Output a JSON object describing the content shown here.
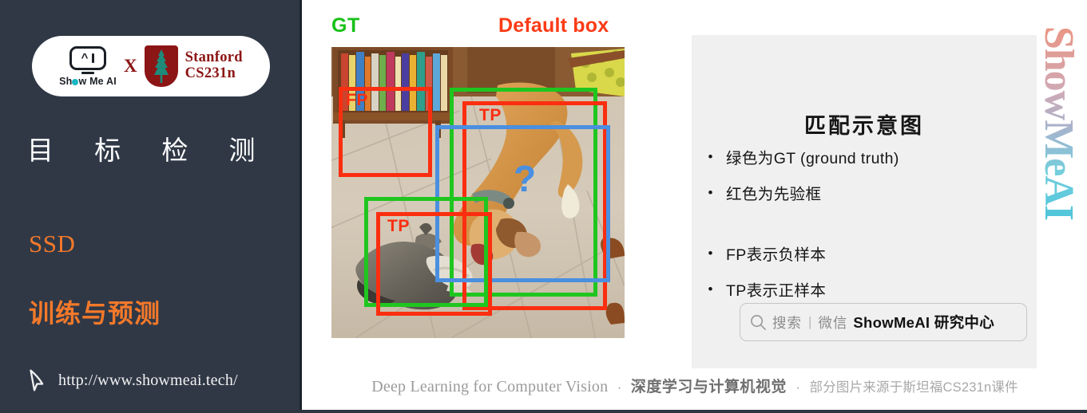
{
  "sidebar": {
    "logo": {
      "showmeai_text": "Show Me AI",
      "cross": "X",
      "stanford_line1": "Stanford",
      "stanford_line2": "CS231n"
    },
    "title": "目 标 检 测",
    "subtitle_1": "SSD",
    "subtitle_2": "训练与预测",
    "url": "http://www.showmeai.tech/",
    "bg_color": "#303846",
    "accent_color": "#F4792A"
  },
  "figure": {
    "label_gt": "GT",
    "label_default": "Default box",
    "gt_color": "#18C018",
    "default_color": "#FB3B16",
    "pred_color": "#4A8FE0",
    "annotations": [
      {
        "label": "FP",
        "color": "#FB2E10"
      },
      {
        "label": "TP",
        "color": "#FB2E10"
      },
      {
        "label": "TP",
        "color": "#FB2E10"
      }
    ],
    "question_mark": "?"
  },
  "right_panel": {
    "title": "匹配示意图",
    "bullets_group_1": [
      {
        "bullet": "•",
        "text": "绿色为GT (ground truth)"
      },
      {
        "bullet": "•",
        "text": "红色为先验框"
      }
    ],
    "bullets_group_2": [
      {
        "bullet": "•",
        "text": "FP表示负样本"
      },
      {
        "bullet": "•",
        "text": "TP表示正样本"
      }
    ],
    "search": {
      "placeholder": "搜索",
      "separator": "|",
      "channel": "微信",
      "brand": "ShowMeAI 研究中心"
    },
    "bg_color": "#f0f0f0"
  },
  "watermark": {
    "text": "ShowMeAI"
  },
  "footer": {
    "en": "Deep Learning for Computer Vision",
    "dot1": "·",
    "cn": "深度学习与计算机视觉",
    "dot2": "·",
    "tail": "部分图片来源于斯坦福CS231n课件"
  }
}
